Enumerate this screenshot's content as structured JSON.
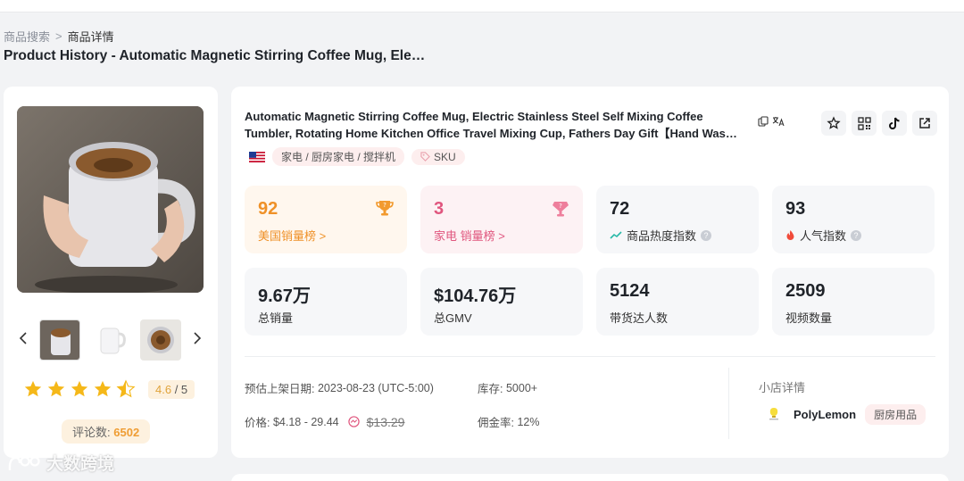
{
  "breadcrumb": {
    "parent": "商品搜索",
    "separator": ">",
    "current": "商品详情"
  },
  "page_title": "Product History - Automatic Magnetic Stirring Coffee Mug, Ele…",
  "product": {
    "title_line1": "Automatic Magnetic Stirring Coffee Mug, Electric Stainless Steel Self Mixing Coffee",
    "title_line2": "Tumbler, Rotating Home Kitchen Office Travel Mixing Cup, Fathers Day Gift【Hand Was…",
    "category": "家电 / 厨房家电 / 搅拌机",
    "sku_label": "SKU",
    "region_flag": "us-flag-icon"
  },
  "gallery": {
    "prev_icon": "chevron-left-icon",
    "next_icon": "chevron-right-icon",
    "rating": "4.6",
    "rating_total": "/ 5",
    "star_count": 4.5,
    "reviews_label": "评论数:",
    "reviews_value": "6502"
  },
  "metrics": [
    {
      "value": "92",
      "label": "美国销量榜 >",
      "icon": "trophy-icon"
    },
    {
      "value": "3",
      "label": "家电 销量榜 >",
      "icon": "diamond-trophy-icon"
    },
    {
      "value": "72",
      "label": "商品热度指数",
      "icon": "trend-icon"
    },
    {
      "value": "93",
      "label": "人气指数",
      "icon": "fire-icon"
    },
    {
      "value": "9.67万",
      "label": "总销量"
    },
    {
      "value": "$104.76万",
      "label": "总GMV"
    },
    {
      "value": "5124",
      "label": "带货达人数"
    },
    {
      "value": "2509",
      "label": "视频数量"
    }
  ],
  "details": {
    "listed_label": "预估上架日期:",
    "listed_value": "2023-08-23 (UTC-5:00)",
    "stock_label": "库存:",
    "stock_value": "5000+",
    "price_label": "价格:",
    "price_value": "$4.18 - 29.44",
    "original_price": "$13.29",
    "commission_label": "佣金率:",
    "commission_value": "12%"
  },
  "shop": {
    "section_title": "小店详情",
    "name": "PolyLemon",
    "category_tag": "厨房用品"
  },
  "watermark": "大数跨境",
  "colors": {
    "orange": "#ef9128",
    "pink": "#e0567e",
    "star": "#f5b819"
  }
}
